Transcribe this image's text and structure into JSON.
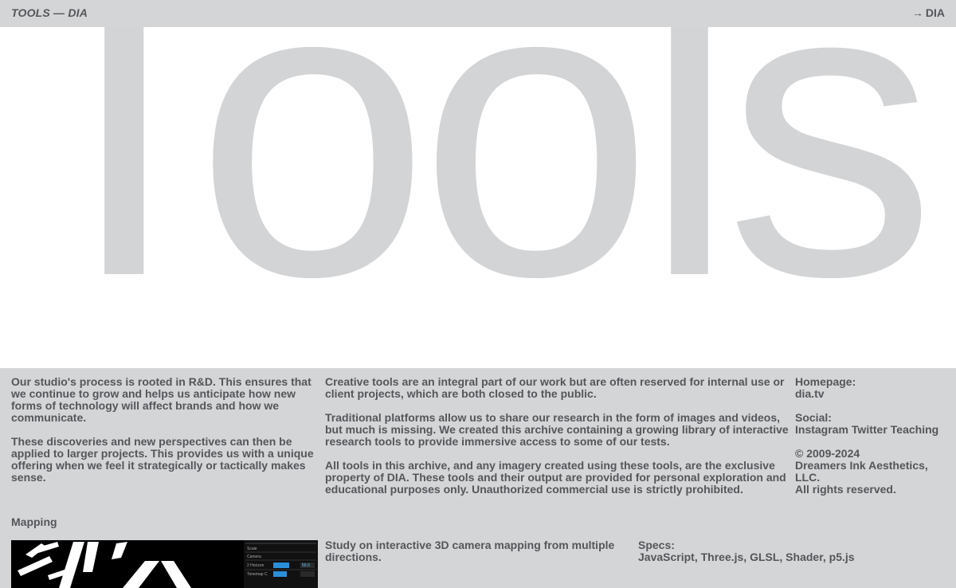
{
  "header": {
    "title": "TOOLS — DIA",
    "link_arrow": "→",
    "link_label": "DIA"
  },
  "hero": {
    "title": "Tools"
  },
  "intro": {
    "left": [
      "Our studio's process is rooted in R&D. This ensures that we continue to grow and helps us anticipate how new forms of technology will affect brands and how we communicate.",
      "These discoveries and new perspectives can then be applied to larger projects. This provides us with a unique offering when we feel it strategically or tactically makes sense."
    ],
    "middle": [
      "Creative tools are an integral part of our work but are often reserved for internal use or client projects, which are both closed to the public.",
      "Traditional platforms allow us to share our research in the form of images and videos, but much is missing. We created this archive containing a growing library of interactive research tools to provide immersive access to some of our tests.",
      "All tools in this archive, and any imagery created using these tools, are the exclusive property of DIA. These tools and their output are provided for personal exploration and educational purposes only. Unauthorized commercial use is strictly prohibited."
    ]
  },
  "meta": {
    "homepage_label": "Homepage:",
    "homepage_link": "dia.tv",
    "social_label": "Social:",
    "social_links": [
      "Instagram",
      "Twitter",
      "Teaching"
    ],
    "copyright_years": "© 2009-2024",
    "copyright_owner": "Dreamers Ink Aesthetics, LLC.",
    "rights": "All rights reserved."
  },
  "tool": {
    "name": "Mapping",
    "description": "Study on interactive 3D camera mapping from multiple directions.",
    "specs_label": "Specs:",
    "specs": "JavaScript, Three.js, GLSL, Shader, p5.js",
    "thumb_ui": {
      "rows": [
        "Scale",
        "Camera",
        "2 Horizon",
        "Tonemap C"
      ],
      "value_1": "50.0"
    }
  },
  "colors": {
    "background": "#d4d5d7",
    "hero_background": "#ffffff",
    "hero_text": "#d3d4d6",
    "text": "#55565a",
    "accent_blue": "#2a8fd8"
  }
}
